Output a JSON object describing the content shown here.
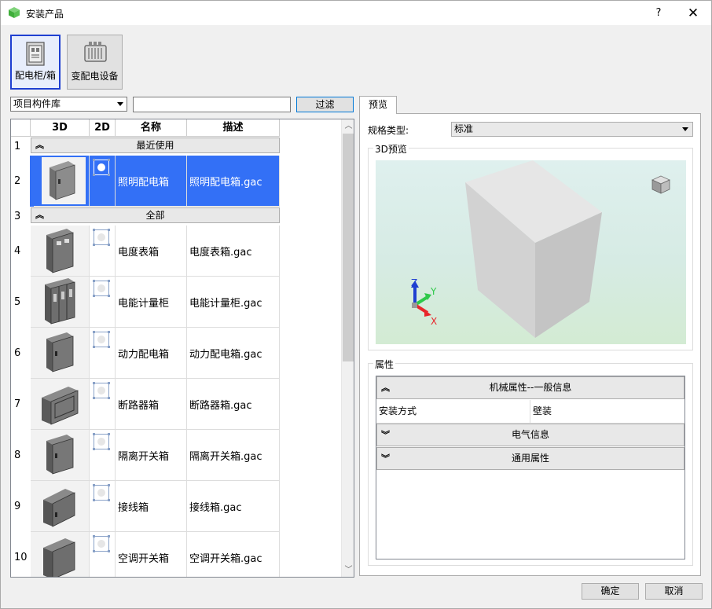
{
  "window": {
    "title": "安装产品",
    "help": "?",
    "close": "✕"
  },
  "categories": [
    {
      "label": "配电柜/箱",
      "icon": "distribution-box-icon",
      "active": true
    },
    {
      "label": "变配电设备",
      "icon": "transformer-icon",
      "active": false
    }
  ],
  "library": {
    "selected": "项目构件库"
  },
  "filter": {
    "value": "",
    "button": "过滤"
  },
  "columns": [
    "3D",
    "2D",
    "名称",
    "描述"
  ],
  "groups": {
    "recent": "最近使用",
    "all": "全部"
  },
  "rows": [
    {
      "num": "1"
    },
    {
      "num": "2",
      "name": "照明配电箱",
      "desc": "照明配电箱.gac"
    },
    {
      "num": "3"
    },
    {
      "num": "4",
      "name": "电度表箱",
      "desc": "电度表箱.gac"
    },
    {
      "num": "5",
      "name": "电能计量柜",
      "desc": "电能计量柜.gac"
    },
    {
      "num": "6",
      "name": "动力配电箱",
      "desc": "动力配电箱.gac"
    },
    {
      "num": "7",
      "name": "断路器箱",
      "desc": "断路器箱.gac"
    },
    {
      "num": "8",
      "name": "隔离开关箱",
      "desc": "隔离开关箱.gac"
    },
    {
      "num": "9",
      "name": "接线箱",
      "desc": "接线箱.gac"
    },
    {
      "num": "10",
      "name": "空调开关箱",
      "desc": "空调开关箱.gac"
    }
  ],
  "preview": {
    "tab": "预览",
    "spec_label": "规格类型:",
    "spec_value": "标准",
    "preview_title": "3D预览",
    "axes": {
      "x": "X",
      "y": "Y",
      "z": "Z"
    },
    "colors": {
      "x": "#e8262b",
      "y": "#2ec84a",
      "z": "#1f3fd1"
    }
  },
  "properties": {
    "title": "属性",
    "mech_header": "机械属性--一般信息",
    "mount_key": "安装方式",
    "mount_value": "壁装",
    "electrical_header": "电气信息",
    "general_header": "通用属性"
  },
  "buttons": {
    "ok": "确定",
    "cancel": "取消"
  }
}
